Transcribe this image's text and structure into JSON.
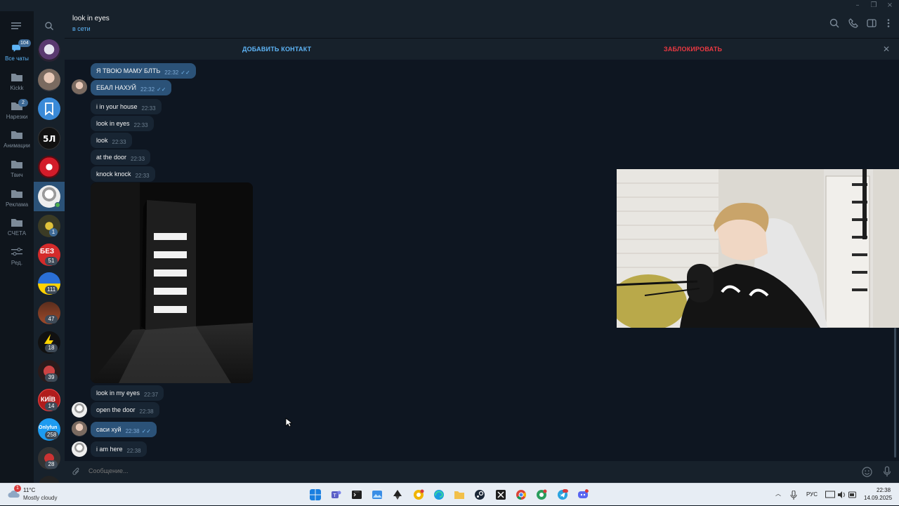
{
  "window": {
    "min": "–",
    "restore": "❐",
    "close": "×"
  },
  "folders": [
    {
      "label": "Все чаты",
      "badge": "104",
      "active": true
    },
    {
      "label": "Kickk",
      "badge": ""
    },
    {
      "label": "Нарезки",
      "badge": "2"
    },
    {
      "label": "Анимации",
      "badge": ""
    },
    {
      "label": "Твич",
      "badge": ""
    },
    {
      "label": "Реклама",
      "badge": ""
    },
    {
      "label": "СЧЕТА",
      "badge": ""
    },
    {
      "label": "Ред.",
      "badge": ""
    }
  ],
  "chat_badges": [
    "1",
    "51",
    "111",
    "47",
    "18",
    "39",
    "14",
    "258",
    "28"
  ],
  "chat_avatar_text": {
    "bez": "БЕЗ",
    "kyiv": "КИЇВ",
    "onlyfun": "Onlyfun"
  },
  "header": {
    "title": "look in eyes",
    "status": "в сети"
  },
  "actions": {
    "add_contact": "ДОБАВИТЬ КОНТАКТ",
    "block": "ЗАБЛОКИРОВАТЬ"
  },
  "messages": [
    {
      "text": "Я ТВОЮ МАМУ БЛТЬ",
      "time": "22:32",
      "dir": "out"
    },
    {
      "text": "ЕБАЛ НАХУЙ",
      "time": "22:32",
      "dir": "out"
    },
    {
      "text": "i in your house",
      "time": "22:33",
      "dir": "in"
    },
    {
      "text": "look in eyes",
      "time": "22:33",
      "dir": "in"
    },
    {
      "text": "look",
      "time": "22:33",
      "dir": "in"
    },
    {
      "text": "at the door",
      "time": "22:33",
      "dir": "in"
    },
    {
      "text": "knock knock",
      "time": "22:33",
      "dir": "in"
    },
    {
      "text": "look in my eyes",
      "time": "22:37",
      "dir": "in"
    },
    {
      "text": "open the door",
      "time": "22:38",
      "dir": "in"
    },
    {
      "text": "саси хуй",
      "time": "22:38",
      "dir": "out"
    },
    {
      "text": "i am here",
      "time": "22:38",
      "dir": "in"
    }
  ],
  "composer": {
    "placeholder": "Сообщение..."
  },
  "taskbar": {
    "weather_badge": "1",
    "temperature": "11°C",
    "weather": "Mostly cloudy",
    "language": "РУС",
    "time": "22:38",
    "date": "14.09.2025",
    "apps": [
      "windows-start",
      "teams",
      "terminal",
      "photos",
      "inkscape",
      "chrome-canary",
      "edge",
      "file-explorer",
      "steam",
      "xbox",
      "chrome",
      "chrome-beta",
      "telegram",
      "discord"
    ]
  },
  "colors": {
    "bg": "#0e1621",
    "panel": "#17212b",
    "accent": "#5eb5f7",
    "danger": "#ec3942",
    "out_bubble": "#2b5278",
    "in_bubble": "#182533"
  }
}
